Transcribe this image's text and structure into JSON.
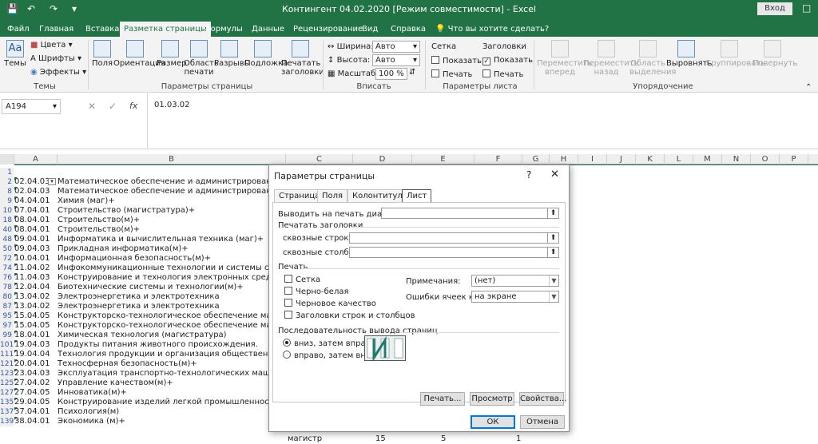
{
  "window": {
    "title": "Контингент 04.02.2020  [Режим совместимости]  -  Excel",
    "signin_label": "Вход",
    "accent": "#217346"
  },
  "tabs": [
    {
      "label": "Файл",
      "active": false
    },
    {
      "label": "Главная",
      "active": false
    },
    {
      "label": "Вставка",
      "active": false
    },
    {
      "label": "Разметка страницы",
      "active": true
    },
    {
      "label": "Формулы",
      "active": false
    },
    {
      "label": "Данные",
      "active": false
    },
    {
      "label": "Рецензирование",
      "active": false
    },
    {
      "label": "Вид",
      "active": false
    },
    {
      "label": "Справка",
      "active": false
    },
    {
      "label": "Что вы хотите сделать?",
      "active": false
    }
  ],
  "ribbon": {
    "themes": {
      "label": "Темы",
      "colors": "Цвета",
      "fonts": "Шрифты",
      "effects": "Эффекты",
      "group": "Темы"
    },
    "page_setup": {
      "margins": "Поля",
      "orientation": "Ориентация",
      "size": "Размер",
      "print_area_1": "Область",
      "print_area_2": "печати",
      "breaks": "Разрывы",
      "background": "Подложка",
      "print_titles_1": "Печатать",
      "print_titles_2": "заголовки",
      "group": "Параметры страницы"
    },
    "fit": {
      "width_label": "Ширина:",
      "width_value": "Авто",
      "height_label": "Высота:",
      "height_value": "Авто",
      "scale_label": "Масштаб:",
      "scale_value": "100 %",
      "group": "Вписать"
    },
    "sheet_options": {
      "gridlines": "Сетка",
      "gridlines_show": "Показать",
      "gridlines_print": "Печать",
      "headings": "Заголовки",
      "headings_show": "Показать",
      "headings_print": "Печать",
      "group": "Параметры листа"
    },
    "arrange": {
      "bring_forward_1": "Переместить",
      "bring_forward_2": "вперед",
      "send_backward_1": "Переместить",
      "send_backward_2": "назад",
      "selection_pane_1": "Область",
      "selection_pane_2": "выделения",
      "align": "Выровнять",
      "group_btn": "Группировать",
      "rotate": "Повернуть",
      "group": "Упорядочение"
    }
  },
  "formula_bar": {
    "name_box": "A194",
    "fx": "fx",
    "value": "01.03.02"
  },
  "columns": [
    "A",
    "B",
    "C",
    "D",
    "E",
    "F",
    "G",
    "H",
    "I",
    "J",
    "K",
    "L",
    "M",
    "N",
    "O",
    "P"
  ],
  "rows": [
    {
      "n": "1",
      "code": "",
      "name": ""
    },
    {
      "n": "2",
      "code": "02.04.03",
      "name": "Математическое обеспечение и администрирование информ"
    },
    {
      "n": "8",
      "code": "02.04.03",
      "name": "Математическое обеспечение и администрирование информ"
    },
    {
      "n": "9",
      "code": "04.04.01",
      "name": "Химия (маг)+"
    },
    {
      "n": "10",
      "code": "07.04.01",
      "name": "Строительство (магистратура)+"
    },
    {
      "n": "18",
      "code": "08.04.01",
      "name": "Строительство(м)+"
    },
    {
      "n": "40",
      "code": "08.04.01",
      "name": "Строительство(м)+"
    },
    {
      "n": "48",
      "code": "09.04.01",
      "name": "Информатика и вычислительная техника (маг)+"
    },
    {
      "n": "50",
      "code": "09.04.03",
      "name": "Прикладная информатика(м)+"
    },
    {
      "n": "72",
      "code": "10.04.01",
      "name": "Информационная безопасность(м)+"
    },
    {
      "n": "74",
      "code": "11.04.02",
      "name": "Инфокоммуникационные технологии и системы связи(м)+"
    },
    {
      "n": "76",
      "code": "11.04.03",
      "name": "Конструирование и технология электронных средств(м)+"
    },
    {
      "n": "78",
      "code": "12.04.04",
      "name": "Биотехнические системы и технологии(м)+"
    },
    {
      "n": "80",
      "code": "13.04.02",
      "name": "Электроэнергетика и электротехника"
    },
    {
      "n": "87",
      "code": "13.04.02",
      "name": "Электроэнергетика и электротехника"
    },
    {
      "n": "95",
      "code": "15.04.05",
      "name": "Конструкторско-технологическое обеспечение машиностро"
    },
    {
      "n": "97",
      "code": "15.04.05",
      "name": "Конструкторско-технологическое обеспечение машиностро"
    },
    {
      "n": "99",
      "code": "18.04.01",
      "name": "Химическая технология (магистратура)"
    },
    {
      "n": "101",
      "code": "19.04.03",
      "name": "Продукты питания животного происхождения."
    },
    {
      "n": "111",
      "code": "19.04.04",
      "name": "Технология продукции и организация общественного питан"
    },
    {
      "n": "121",
      "code": "20.04.01",
      "name": "Техносферная безопасность(м)+"
    },
    {
      "n": "123",
      "code": "23.04.03",
      "name": "Эксплуатация транспортно-технологических машин и компл"
    },
    {
      "n": "125",
      "code": "27.04.02",
      "name": "Управление качеством(м)+"
    },
    {
      "n": "127",
      "code": "27.04.05",
      "name": "Инноватика(м)+"
    },
    {
      "n": "135",
      "code": "29.04.05",
      "name": "Конструирование изделий легкой промышленности(м)+"
    },
    {
      "n": "137",
      "code": "37.04.01",
      "name": "Психология(м)"
    },
    {
      "n": "139",
      "code": "38.04.01",
      "name": "Экономика (м)+"
    }
  ],
  "last_row_extra": {
    "c": "магистр",
    "d": "15",
    "e": "5",
    "f": "1"
  },
  "dialog": {
    "title": "Параметры страницы",
    "help": "?",
    "close": "✕",
    "tabs": [
      "Страница",
      "Поля",
      "Колонтитулы",
      "Лист"
    ],
    "print_area_label": "Выводить на печать диапазон:",
    "print_titles_label": "Печатать заголовки",
    "rows_repeat_label": "сквозные строки:",
    "cols_repeat_label": "сквозные столбцы:",
    "print_label": "Печать",
    "grid_label": "Сетка",
    "bw_label": "Черно-белая",
    "draft_label": "Черновое качество",
    "headings_label": "Заголовки строк и столбцов",
    "comments_label": "Примечания:",
    "comments_value": "(нет)",
    "errors_label": "Ошибки ячеек как:",
    "errors_value": "на экране",
    "order_label": "Последовательность вывода страниц",
    "order_down": "вниз, затем вправо",
    "order_over": "вправо, затем вниз",
    "print_btn": "Печать...",
    "preview_btn": "Просмотр",
    "options_btn": "Свойства...",
    "ok_btn": "ОК",
    "cancel_btn": "Отмена"
  }
}
